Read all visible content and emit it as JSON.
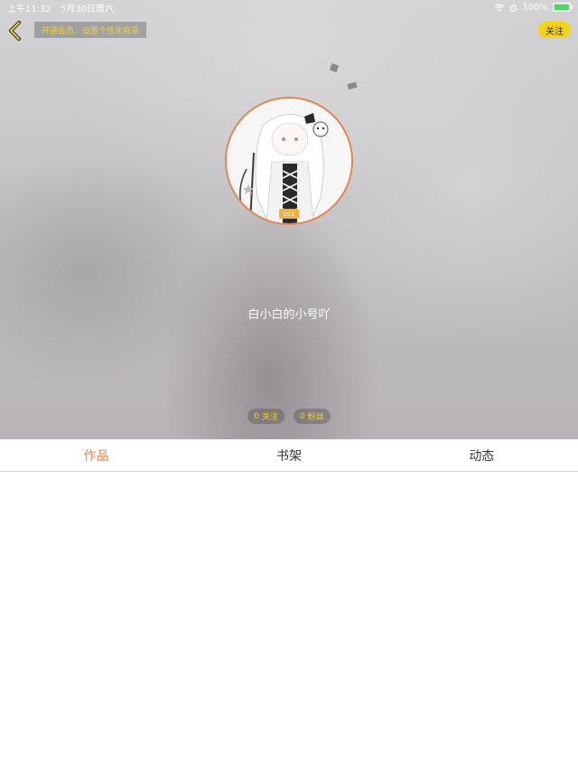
{
  "status_bar": {
    "time": "上午11:32",
    "date": "5月30日周六",
    "battery": "100%"
  },
  "header": {
    "vip_banner": "开通会员，设置个性化背景",
    "follow_label": "关注"
  },
  "profile": {
    "username": "白小白的小号吖",
    "level_badge": "LV1",
    "following_count": "0",
    "following_label": "关注",
    "fans_count": "0",
    "fans_label": "粉丝"
  },
  "tabs": [
    {
      "label": "作品",
      "active": true
    },
    {
      "label": "书架",
      "active": false
    },
    {
      "label": "动态",
      "active": false
    }
  ],
  "colors": {
    "accent": "#e9834d",
    "follow_button": "#f5d313",
    "banner_text": "#f2d32b"
  }
}
